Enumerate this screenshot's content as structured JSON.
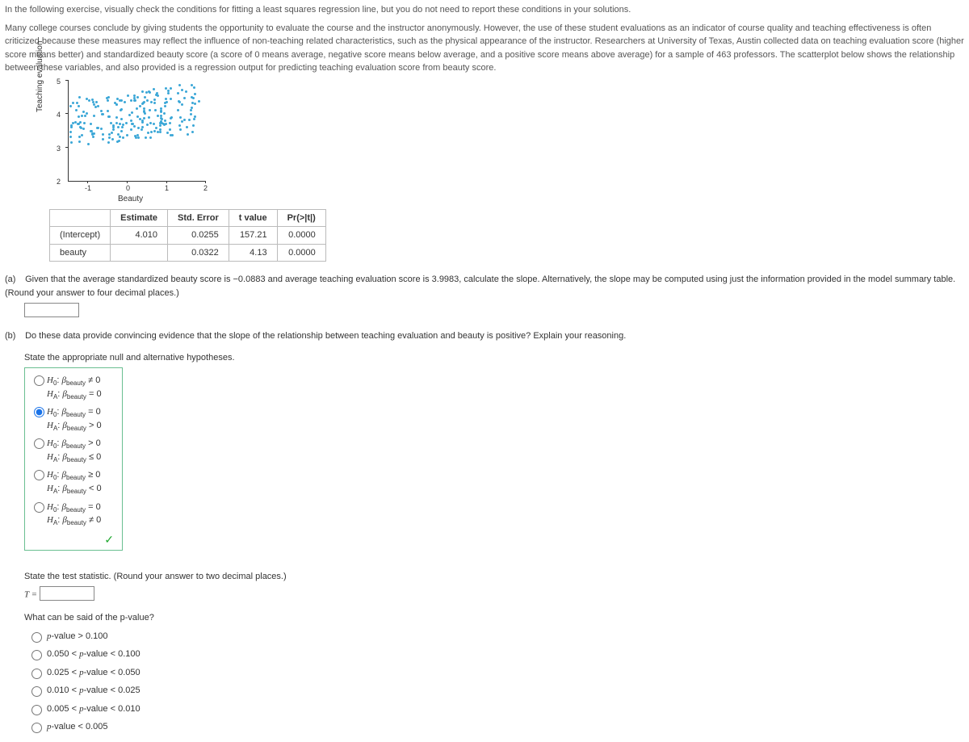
{
  "instruction": "In the following exercise, visually check the conditions for fitting a least squares regression line, but you do not need to report these conditions in your solutions.",
  "paragraph": "Many college courses conclude by giving students the opportunity to evaluate the course and the instructor anonymously. However, the use of these student evaluations as an indicator of course quality and teaching effectiveness is often criticized because these measures may reflect the influence of non-teaching related characteristics, such as the physical appearance of the instructor. Researchers at University of Texas, Austin collected data on teaching evaluation score (higher score means better) and standardized beauty score (a score of 0 means average, negative score means below average, and a positive score means above average) for a sample of 463 professors. The scatterplot below shows the relationship between these variables, and also provided is a regression output for predicting teaching evaluation score from beauty score.",
  "chart_data": {
    "type": "scatter",
    "title": "",
    "xlabel": "Beauty",
    "ylabel": "Teaching evaluation",
    "xlim": [
      -1.5,
      2
    ],
    "ylim": [
      2,
      5
    ],
    "xticks": [
      -1,
      0,
      1,
      2
    ],
    "yticks": [
      2,
      3,
      4,
      5
    ],
    "n_points": 463,
    "series": [
      {
        "name": "professors",
        "description": "cloud of ~463 points, x mostly between -1.5 and 2, y mostly between 2.5 and 5, slight positive trend"
      }
    ]
  },
  "regtable": {
    "headers": [
      "",
      "Estimate",
      "Std. Error",
      "t value",
      "Pr(>|t|)"
    ],
    "rows": [
      {
        "label": "(Intercept)",
        "est": "4.010",
        "se": "0.0255",
        "t": "157.21",
        "p": "0.0000"
      },
      {
        "label": "beauty",
        "est": "",
        "se": "0.0322",
        "t": "4.13",
        "p": "0.0000"
      }
    ]
  },
  "partA": {
    "label": "(a)",
    "text": "Given that the average standardized beauty score is −0.0883 and average teaching evaluation score is 3.9983, calculate the slope. Alternatively, the slope may be computed using just the information provided in the model summary table. (Round your answer to four decimal places.)"
  },
  "partB": {
    "label": "(b)",
    "intro": "Do these data provide convincing evidence that the slope of the relationship between teaching evaluation and beauty is positive? Explain your reasoning.",
    "state_hyp": "State the appropriate null and alternative hypotheses.",
    "options": [
      {
        "h0": "≠ 0",
        "ha": "= 0"
      },
      {
        "h0": "= 0",
        "ha": "> 0"
      },
      {
        "h0": "> 0",
        "ha": "≤ 0"
      },
      {
        "h0": "≥ 0",
        "ha": "< 0"
      },
      {
        "h0": "= 0",
        "ha": "≠ 0"
      }
    ],
    "selected": 1,
    "state_stat": "State the test statistic. (Round your answer to two decimal places.)",
    "t_label": "T =",
    "pval_q": "What can be said of the p-value?",
    "pval_opts": [
      "p-value > 0.100",
      "0.050 < p-value < 0.100",
      "0.025 < p-value < 0.050",
      "0.010 < p-value < 0.025",
      "0.005 < p-value < 0.010",
      "p-value < 0.005"
    ]
  }
}
